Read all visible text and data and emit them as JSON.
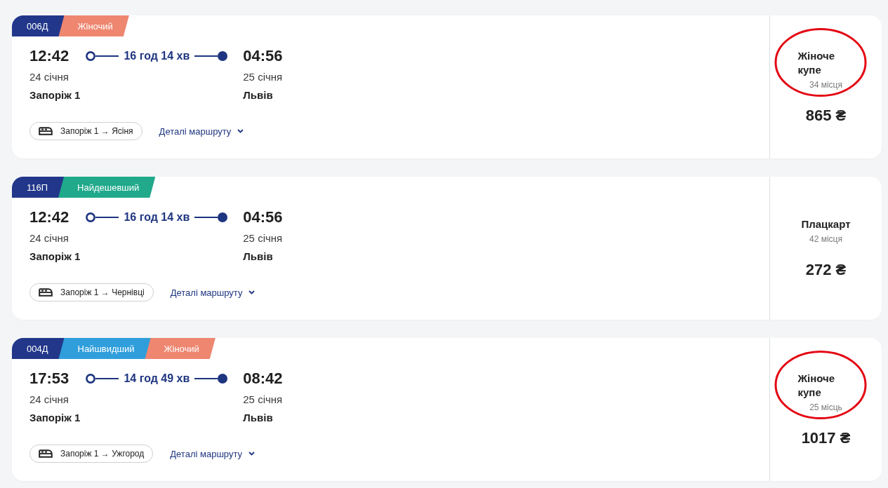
{
  "trains": [
    {
      "number": "006Д",
      "tags": [
        {
          "label": "Жіночий",
          "color": "#ee8670"
        }
      ],
      "departure": {
        "time": "12:42",
        "date": "24 січня",
        "station": "Запоріж 1"
      },
      "duration": "16 год 14 хв",
      "arrival": {
        "time": "04:56",
        "date": "25 січня",
        "station": "Львів"
      },
      "route": "Запоріж 1 → Ясіня",
      "details_link": "Деталі маршруту",
      "fare": {
        "class": "Жіноче купе",
        "seats": "34 місця",
        "price": "865 ₴",
        "circled": true
      }
    },
    {
      "number": "116П",
      "tags": [
        {
          "label": "Найдешевший",
          "color": "#20a98b"
        }
      ],
      "departure": {
        "time": "12:42",
        "date": "24 січня",
        "station": "Запоріж 1"
      },
      "duration": "16 год 14 хв",
      "arrival": {
        "time": "04:56",
        "date": "25 січня",
        "station": "Львів"
      },
      "route": "Запоріж 1 → Чернівці",
      "details_link": "Деталі маршруту",
      "fare": {
        "class": "Плацкарт",
        "seats": "42 місця",
        "price": "272 ₴",
        "circled": false
      }
    },
    {
      "number": "004Д",
      "tags": [
        {
          "label": "Найшвидший",
          "color": "#2f9edb"
        },
        {
          "label": "Жіночий",
          "color": "#ee8670"
        }
      ],
      "departure": {
        "time": "17:53",
        "date": "24 січня",
        "station": "Запоріж 1"
      },
      "duration": "14 год 49 хв",
      "arrival": {
        "time": "08:42",
        "date": "25 січня",
        "station": "Львів"
      },
      "route": "Запоріж 1 → Ужгород",
      "details_link": "Деталі маршруту",
      "fare": {
        "class": "Жіноче купе",
        "seats": "25 місць",
        "price": "1017 ₴",
        "circled": true
      }
    }
  ]
}
